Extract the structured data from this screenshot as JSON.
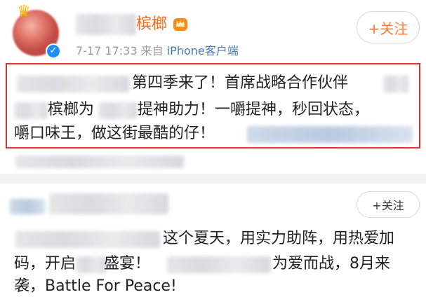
{
  "post1": {
    "author_visible_suffix": "槟榔",
    "timestamp": "7-17 17:33",
    "source_prefix": "来自",
    "source": "iPhone客户端",
    "follow_label": "+关注",
    "text_line1": "第四季来了！首席战略合作伙伴",
    "text_line2a": "槟榔为",
    "text_line2b": "提神助力！一嚼提神，秒回状态，",
    "text_line3": "嚼口味王，做这街最酷的仔！"
  },
  "post2": {
    "follow_label": "+关注",
    "text_line1": "这个夏天，用实力助阵，用热爱加",
    "text_line2a": "码，开启",
    "text_line2b": "盛宴！",
    "text_line2c": "为爱而战，8月来",
    "text_line3": "袭，Battle For Peace!"
  },
  "colors": {
    "accent_orange": "#ff7a3a",
    "name_orange": "#ff6a1a",
    "highlight_border": "#e0312b",
    "verified_blue": "#1f8ef1",
    "link_blue": "#4a7ab7"
  }
}
